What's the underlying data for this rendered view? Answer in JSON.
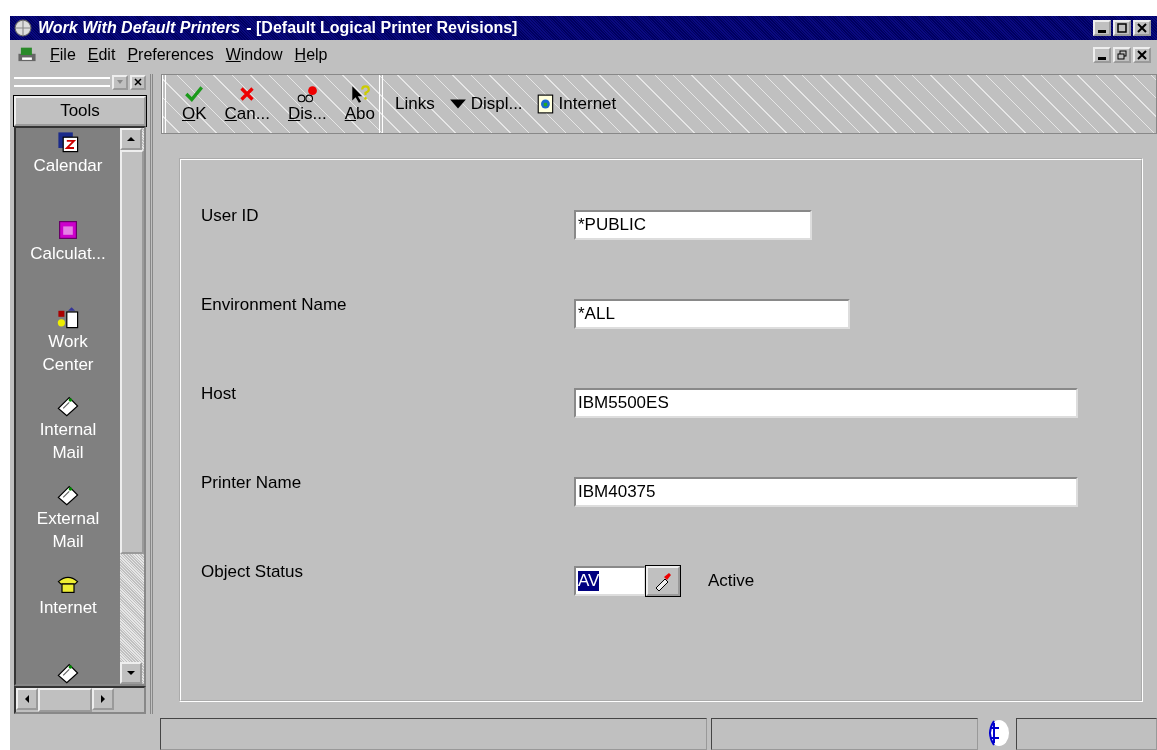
{
  "window": {
    "app_title": "Work With Default Printers",
    "title": "- [Default Logical Printer Revisions]"
  },
  "menu": [
    {
      "label": "File"
    },
    {
      "label": "Edit"
    },
    {
      "label": "Preferences"
    },
    {
      "label": "Window"
    },
    {
      "label": "Help"
    }
  ],
  "sidebar": {
    "title": "Tools",
    "items": [
      {
        "label": "Calendar",
        "kind": "calendar"
      },
      {
        "label": "Calculat...",
        "kind": "calculator"
      },
      {
        "label": "Work Center",
        "kind": "workcenter"
      },
      {
        "label": "Internal Mail",
        "kind": "mail"
      },
      {
        "label": "External Mail",
        "kind": "mail"
      },
      {
        "label": "Internet",
        "kind": "phone"
      },
      {
        "kind": "mail"
      }
    ]
  },
  "toolbar": [
    {
      "label": "OK",
      "kind": "check"
    },
    {
      "label": "Can...",
      "kind": "cancel"
    },
    {
      "label": "Dis...",
      "kind": "display"
    },
    {
      "label": "Abo",
      "kind": "about"
    }
  ],
  "links": [
    {
      "label": "Links",
      "kind": "plain"
    },
    {
      "label": "Displ...",
      "kind": "dropdown"
    },
    {
      "label": "Internet",
      "kind": "internet"
    }
  ],
  "form": [
    {
      "label": "User ID",
      "value": "*PUBLIC",
      "kind": "text",
      "selected": false
    },
    {
      "label": "Environment Name",
      "value": "*ALL",
      "kind": "text",
      "selected": false
    },
    {
      "label": "Host",
      "value": "IBM5500ES",
      "kind": "text",
      "selected": false
    },
    {
      "label": "Printer Name",
      "value": "IBM40375",
      "kind": "text",
      "selected": false
    },
    {
      "label": "Object Status",
      "value": "AV",
      "kind": "lookup",
      "description": "Active",
      "selected": true
    }
  ]
}
